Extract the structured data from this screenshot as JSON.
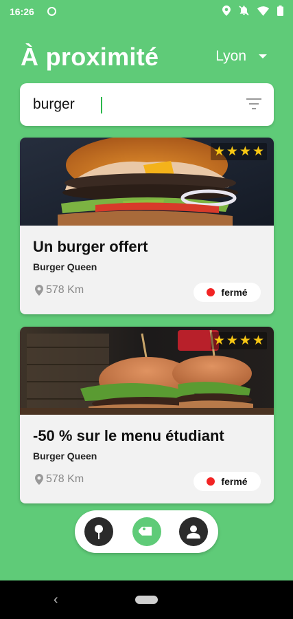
{
  "status_bar": {
    "time": "16:26"
  },
  "header": {
    "title": "À proximité",
    "city": "Lyon"
  },
  "search": {
    "value": "burger",
    "placeholder": ""
  },
  "cards": [
    {
      "title": "Un burger offert",
      "vendor": "Burger Queen",
      "distance": "578 Km",
      "status": "fermé",
      "rating": 4
    },
    {
      "title": "-50 % sur le menu étudiant",
      "vendor": "Burger Queen",
      "distance": "578 Km",
      "status": "fermé",
      "rating": 4
    }
  ],
  "bottom_nav": {
    "items": [
      "map-pin-icon",
      "tag-icon",
      "user-icon"
    ],
    "active": "tag-icon"
  },
  "colors": {
    "background": "#5fcb78",
    "accent": "#2db84d",
    "closed": "#f22424",
    "star": "#f7c613"
  }
}
